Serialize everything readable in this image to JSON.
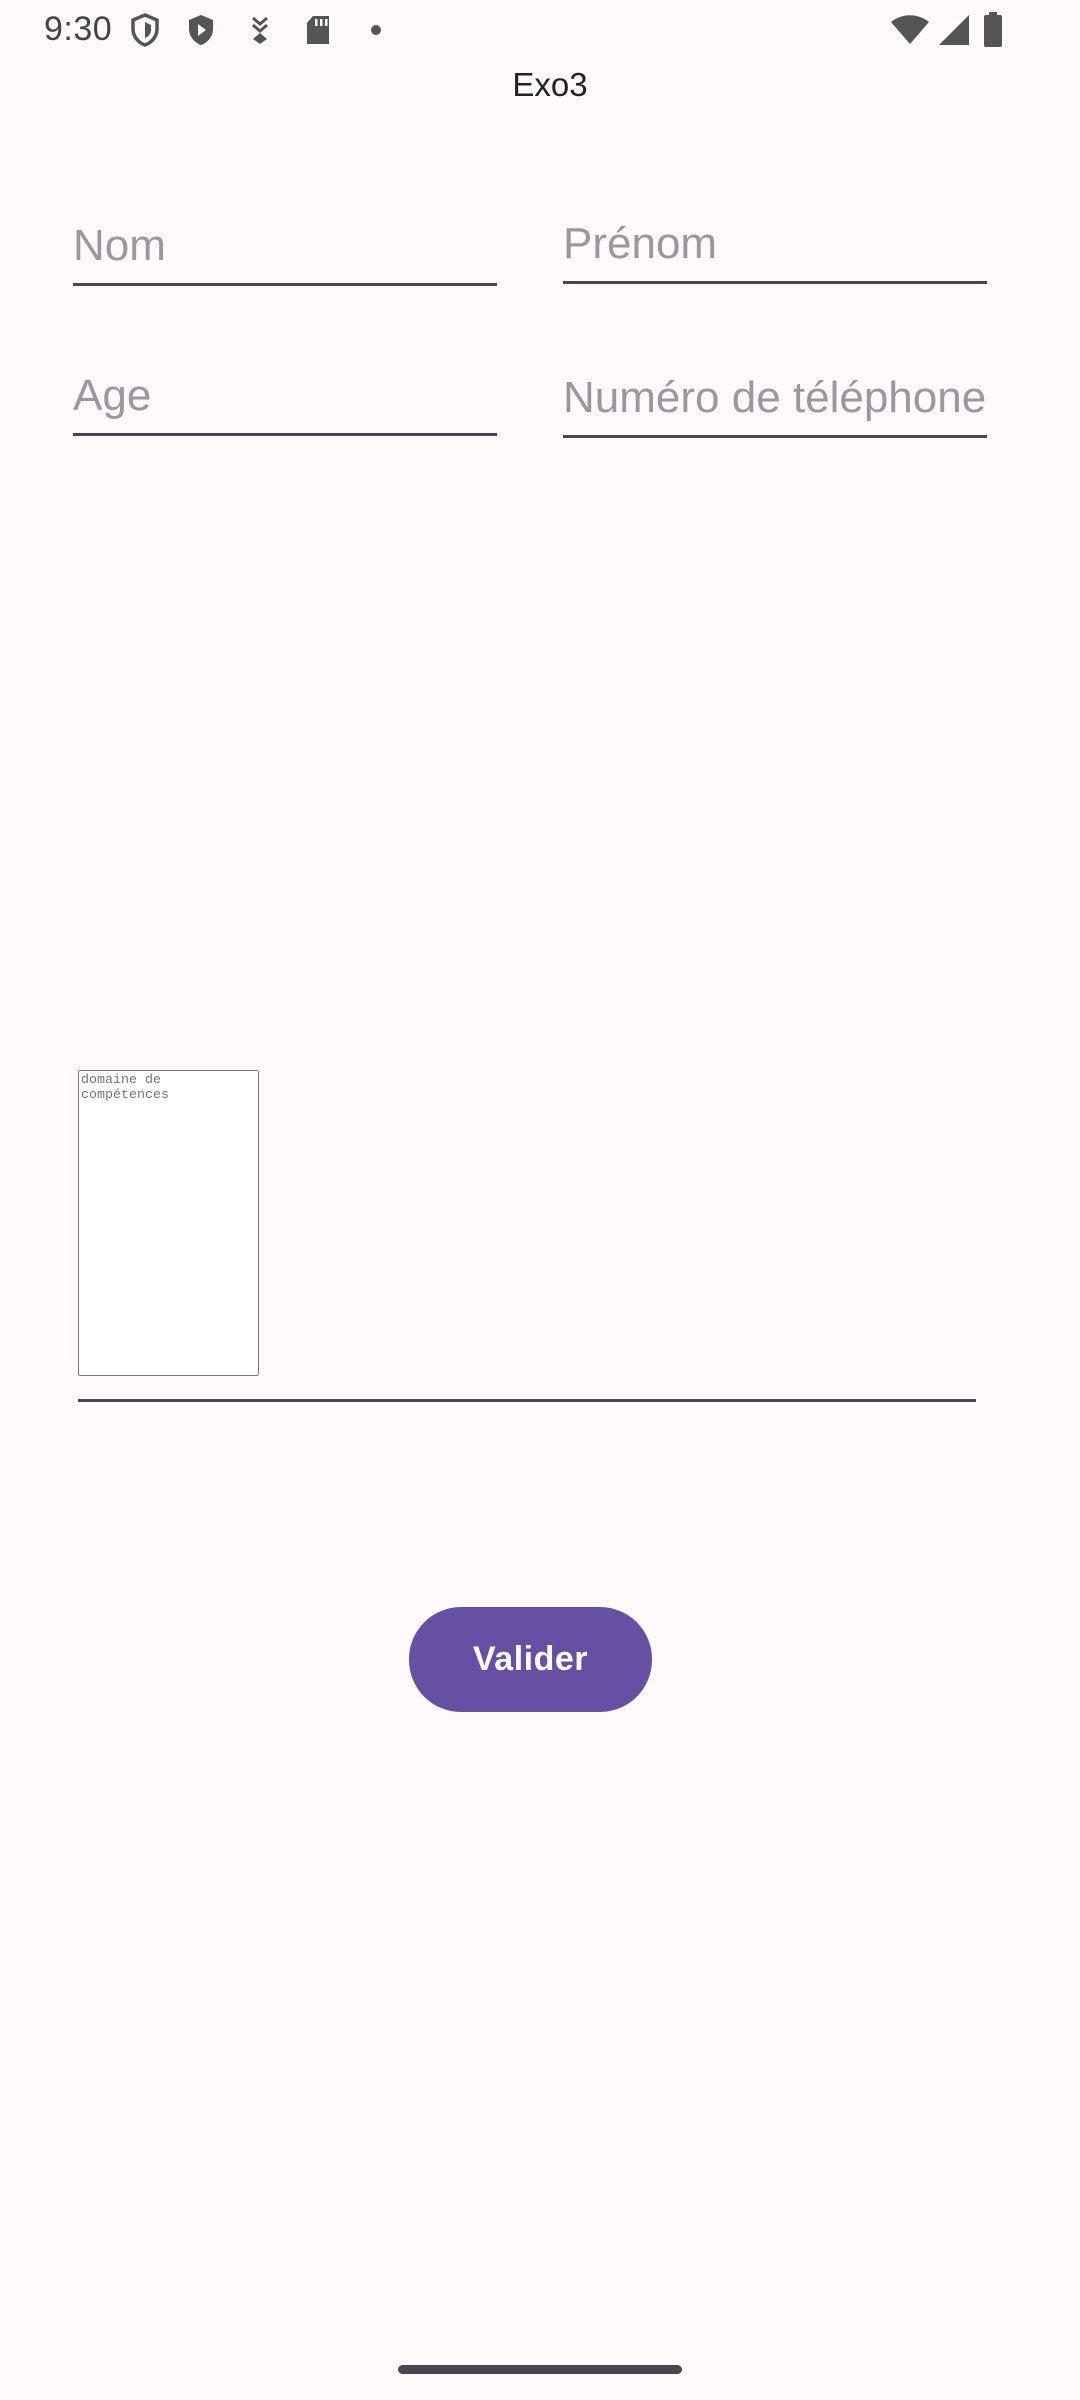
{
  "status_bar": {
    "time": "9:30",
    "left_icons": [
      "shield-icon",
      "play-protect-icon",
      "download-icon",
      "sd-card-icon",
      "dot-icon"
    ],
    "right_icons": [
      "wifi-icon",
      "cell-signal-icon",
      "battery-icon"
    ]
  },
  "app": {
    "title": "Exo3"
  },
  "form": {
    "nom": {
      "placeholder": "Nom",
      "value": ""
    },
    "prenom": {
      "placeholder": "Prénom",
      "value": ""
    },
    "age": {
      "placeholder": "Age",
      "value": ""
    },
    "telephone": {
      "placeholder": "Numéro de téléphone",
      "value": ""
    },
    "domaine": {
      "placeholder": "domaine de compétences",
      "value": ""
    },
    "submit_label": "Valider"
  },
  "colors": {
    "background": "#FFF9FC",
    "primary": "#6750A4",
    "on_primary": "#FFFFFF",
    "hint": "#9D969F",
    "underline": "#4A454E"
  }
}
